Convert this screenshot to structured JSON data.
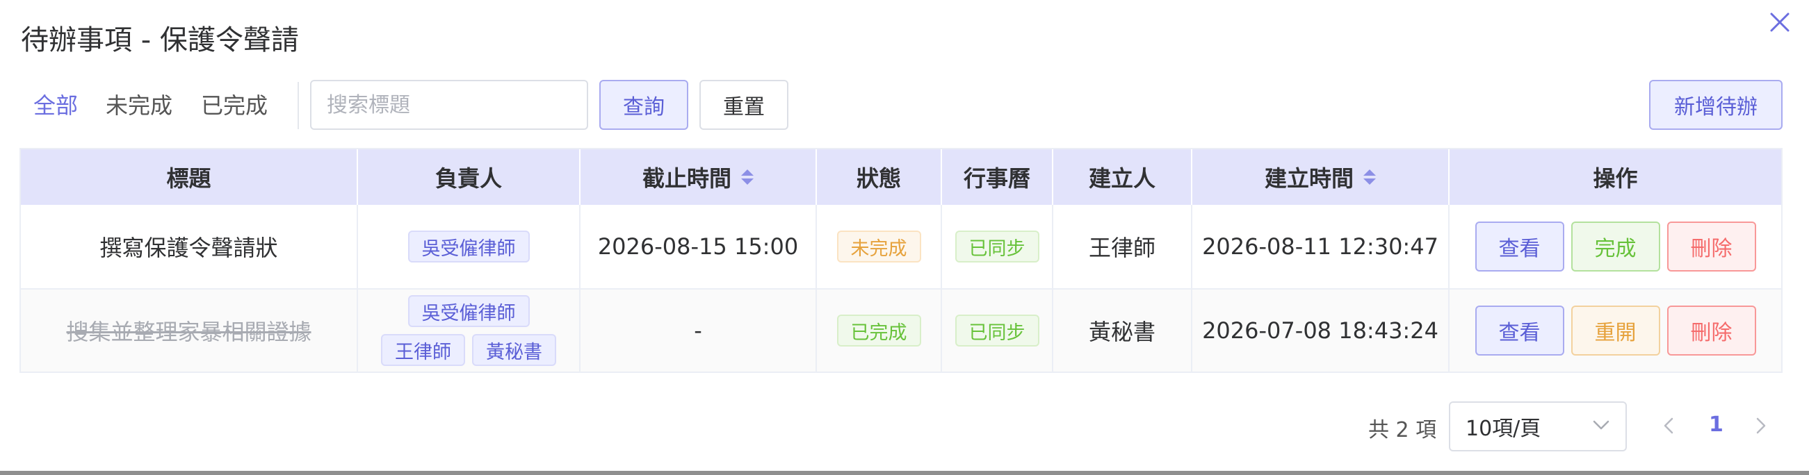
{
  "dialog": {
    "title": "待辦事項 - 保護令聲請"
  },
  "toolbar": {
    "filters": [
      "全部",
      "未完成",
      "已完成"
    ],
    "search_placeholder": "搜索標題",
    "search_value": "",
    "query_label": "查詢",
    "reset_label": "重置",
    "add_label": "新增待辦"
  },
  "table": {
    "headers": [
      "標題",
      "負責人",
      "截止時間",
      "狀態",
      "行事曆",
      "建立人",
      "建立時間",
      "操作"
    ],
    "rows": [
      {
        "title": "撰寫保護令聲請狀",
        "assignees": [
          "吳受僱律師"
        ],
        "deadline": "2026-08-15 15:00",
        "status": "未完成",
        "calendar": "已同步",
        "creator": "王律師",
        "created_at": "2026-08-11 12:30:47",
        "actions": [
          "查看",
          "完成",
          "刪除"
        ]
      },
      {
        "title": "搜集並整理家暴相關證據",
        "assignees": [
          "吳受僱律師",
          "王律師",
          "黃秘書"
        ],
        "deadline": "-",
        "status": "已完成",
        "calendar": "已同步",
        "creator": "黃秘書",
        "created_at": "2026-07-08 18:43:24",
        "actions": [
          "查看",
          "重開",
          "刪除"
        ]
      }
    ]
  },
  "pagination": {
    "total_text": "共 2 項",
    "page_size": "10項/頁",
    "current_page": "1"
  },
  "colors": {
    "accent": "#5a5ed6",
    "header_bg": "#e2e3fb",
    "success": "#67c23a",
    "warning": "#e6a23c",
    "danger": "#f56c6c"
  }
}
